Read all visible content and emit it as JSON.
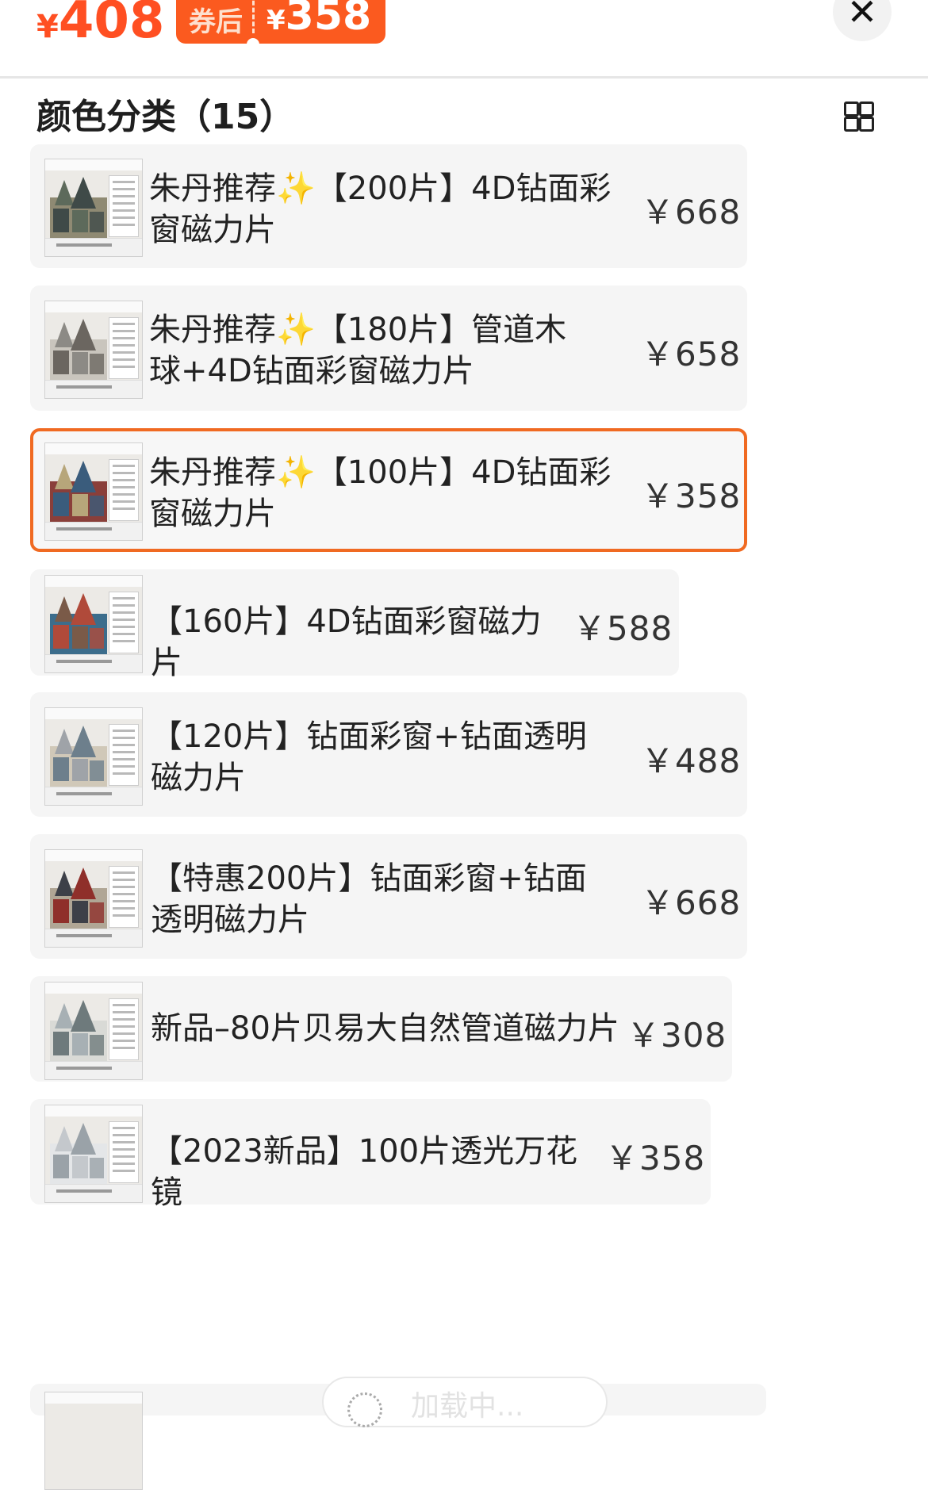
{
  "header": {
    "original_price_currency": "¥",
    "original_price": "408",
    "coupon_label": "券后",
    "coupon_price_currency": "¥",
    "coupon_price": "358",
    "close_icon": "close-icon"
  },
  "section": {
    "title": "颜色分类（15）",
    "view_toggle_icon": "grid-view-icon"
  },
  "items": [
    {
      "name_parts": [
        "朱丹推荐",
        "✨",
        "【200片】4D钻面彩窗磁力片"
      ],
      "price": "￥668",
      "selected": false
    },
    {
      "name_parts": [
        "朱丹推荐",
        "✨",
        "【180片】管道木球+4D钻面彩窗磁力片"
      ],
      "price": "￥658",
      "selected": false
    },
    {
      "name_parts": [
        "朱丹推荐",
        "✨",
        "【100片】4D钻面彩窗磁力片"
      ],
      "price": "￥358",
      "selected": true
    },
    {
      "name_parts": [
        "【160片】4D钻面彩窗磁力片"
      ],
      "price": "￥588",
      "selected": false
    },
    {
      "name_parts": [
        "【120片】钻面彩窗+钻面透明磁力片"
      ],
      "price": "￥488",
      "selected": false
    },
    {
      "name_parts": [
        "【特惠200片】钻面彩窗+钻面透明磁力片"
      ],
      "price": "￥668",
      "selected": false
    },
    {
      "name_parts": [
        "新品–80片贝易大自然管道磁力片"
      ],
      "price": "￥308",
      "selected": false
    },
    {
      "name_parts": [
        "【2023新品】100片透光万花镜"
      ],
      "price": "￥358",
      "selected": false
    }
  ],
  "floating_button": {
    "label": "加载中..."
  },
  "colors": {
    "accent": "#fb5a1f",
    "selected_border": "#f06a22",
    "card_bg": "#f5f5f5"
  }
}
